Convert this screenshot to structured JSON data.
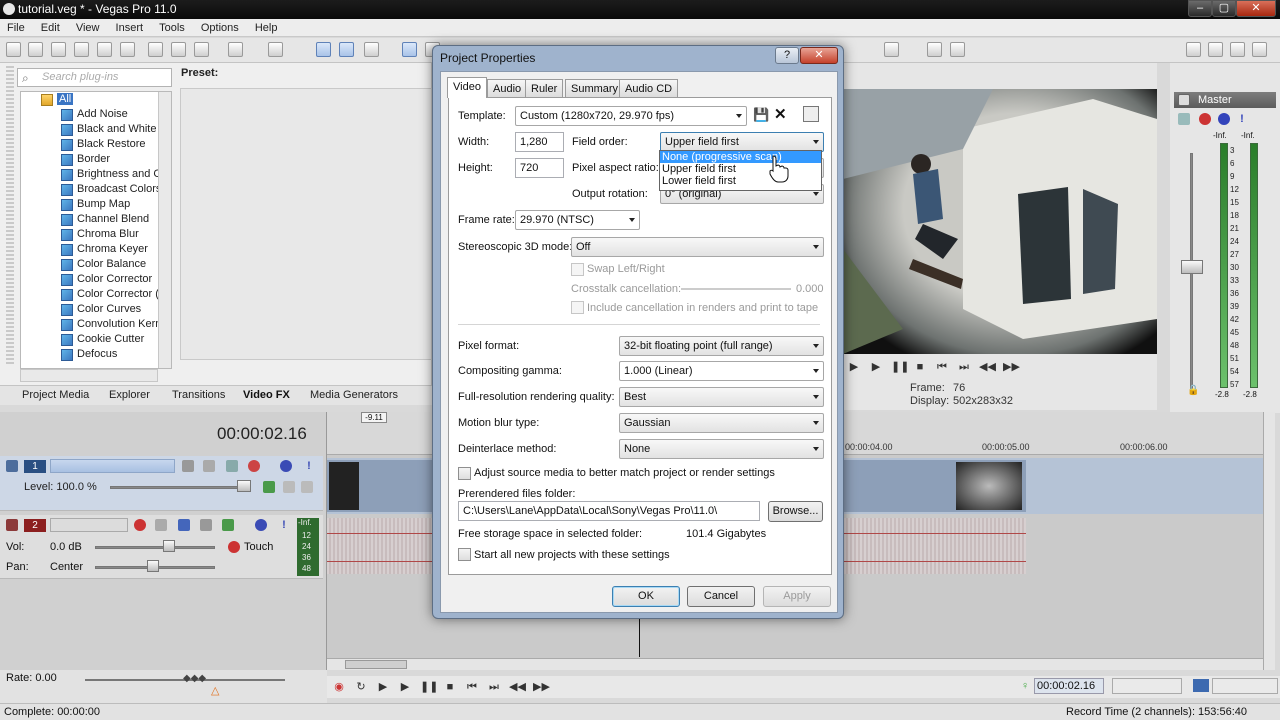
{
  "window": {
    "title": "tutorial.veg * - Vegas Pro 11.0",
    "min": "–",
    "max": "▢",
    "close": "✕"
  },
  "menu": [
    "File",
    "Edit",
    "View",
    "Insert",
    "Tools",
    "Options",
    "Help"
  ],
  "plugins": {
    "search_placeholder": "Search plug-ins",
    "preset_label": "Preset:",
    "root": "All",
    "items": [
      "Add Noise",
      "Black and White",
      "Black Restore",
      "Border",
      "Brightness and Co",
      "Broadcast Colors",
      "Bump Map",
      "Channel Blend",
      "Chroma Blur",
      "Chroma Keyer",
      "Color Balance",
      "Color Corrector",
      "Color Corrector (S",
      "Color Curves",
      "Convolution Kerne",
      "Cookie Cutter",
      "Defocus"
    ]
  },
  "bottom_tabs": [
    "Project Media",
    "Explorer",
    "Transitions",
    "Video FX",
    "Media Generators"
  ],
  "active_bottom_tab": "Video FX",
  "timecode": "00:00:02.16",
  "ruler": {
    "marker": "-9.11",
    "labels": [
      "00:00:04.00",
      "00:00:05.00",
      "00:00:06.00"
    ]
  },
  "video_track": {
    "number": "1",
    "level_label": "Level: 100.0 %"
  },
  "audio_track": {
    "number": "2",
    "vol_label": "Vol:",
    "vol_value": "0.0 dB",
    "pan_label": "Pan:",
    "pan_value": "Center",
    "mode": "Touch",
    "meter": [
      "-Inf.",
      "12",
      "24",
      "36",
      "48"
    ]
  },
  "preview_info": {
    "frame_label": "Frame:",
    "frame_value": "76",
    "display_label": "Display:",
    "display_value": "502x283x32"
  },
  "mixer": {
    "title": "Master",
    "scale": [
      "-Inf.",
      "3",
      "6",
      "9",
      "12",
      "15",
      "18",
      "21",
      "24",
      "27",
      "30",
      "33",
      "36",
      "39",
      "42",
      "45",
      "48",
      "51",
      "54",
      "57"
    ],
    "bottom_left": "-2.8",
    "bottom_right": "-2.8",
    "top_left": "-Inf.",
    "top_right": "-Inf."
  },
  "rate_label": "Rate: 0.00",
  "status": {
    "left": "Complete: 00:00:00",
    "right": "Record Time (2 channels): 153:56:40"
  },
  "transport_time": "00:00:02.16",
  "dialog": {
    "title": "Project Properties",
    "help": "?",
    "close": "✕",
    "tabs": [
      "Video",
      "Audio",
      "Ruler",
      "Summary",
      "Audio CD"
    ],
    "active_tab": "Video",
    "template_label": "Template:",
    "template_value": "Custom (1280x720, 29.970 fps)",
    "width_label": "Width:",
    "width_value": "1,280",
    "height_label": "Height:",
    "height_value": "720",
    "field_order_label": "Field order:",
    "field_order_value": "Upper field first",
    "field_order_options": [
      "None (progressive scan)",
      "Upper field first",
      "Lower field first"
    ],
    "pixel_aspect_label": "Pixel aspect ratio:",
    "output_rotation_label": "Output rotation:",
    "output_rotation_value": "0° (original)",
    "frame_rate_label": "Frame rate:",
    "frame_rate_value": "29.970 (NTSC)",
    "stereo_label": "Stereoscopic 3D mode:",
    "stereo_value": "Off",
    "swap_label": "Swap Left/Right",
    "crosstalk_label": "Crosstalk cancellation:",
    "crosstalk_value": "0.000",
    "include_cancel_label": "Include cancellation in renders and print to tape",
    "pixel_format_label": "Pixel format:",
    "pixel_format_value": "32-bit floating point (full range)",
    "gamma_label": "Compositing gamma:",
    "gamma_value": "1.000 (Linear)",
    "quality_label": "Full-resolution rendering quality:",
    "quality_value": "Best",
    "blur_label": "Motion blur type:",
    "blur_value": "Gaussian",
    "deinterlace_label": "Deinterlace method:",
    "deinterlace_value": "None",
    "adjust_label": "Adjust source media to better match project or render settings",
    "prerender_label": "Prerendered files folder:",
    "prerender_value": "C:\\Users\\Lane\\AppData\\Local\\Sony\\Vegas Pro\\11.0\\",
    "browse": "Browse...",
    "free_label": "Free storage space in selected folder:",
    "free_value": "101.4 Gigabytes",
    "start_all_label": "Start all new projects with these settings",
    "ok": "OK",
    "cancel": "Cancel",
    "apply": "Apply"
  }
}
